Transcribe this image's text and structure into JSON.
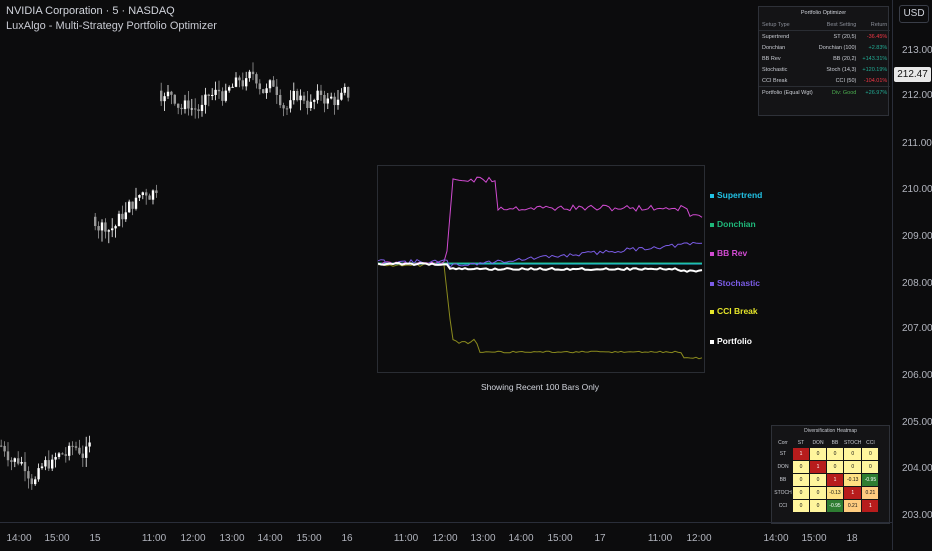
{
  "header": {
    "symbol_line": "NVIDIA Corporation · 5 · NASDAQ",
    "indicator_line": "LuxAlgo - Multi-Strategy Portfolio Optimizer"
  },
  "price_scale": {
    "currency": "USD",
    "current_price": "212.47",
    "ticks": [
      "213.00",
      "212.00",
      "211.00",
      "210.00",
      "209.00",
      "208.00",
      "207.00",
      "206.00",
      "205.00",
      "204.00",
      "203.00"
    ]
  },
  "time_axis": {
    "labels": [
      "14:00",
      "15:00",
      "15",
      "11:00",
      "12:00",
      "13:00",
      "14:00",
      "15:00",
      "16",
      "11:00",
      "12:00",
      "13:00",
      "14:00",
      "15:00",
      "17",
      "11:00",
      "12:00",
      "14:00",
      "15:00",
      "18"
    ]
  },
  "optimizer": {
    "title": "Portfolio Optimizer",
    "columns": [
      "Setup Type",
      "Best Setting",
      "Return"
    ],
    "rows": [
      {
        "type": "Supertrend",
        "setting": "ST (20,5)",
        "ret": "-36.45%",
        "sign": "neg"
      },
      {
        "type": "Donchian",
        "setting": "Donchian (100)",
        "ret": "+2.83%",
        "sign": "pos"
      },
      {
        "type": "BB Rev",
        "setting": "BB (20,2)",
        "ret": "+143.31%",
        "sign": "pos"
      },
      {
        "type": "Stochastic",
        "setting": "Stoch (14,3)",
        "ret": "+120.19%",
        "sign": "pos"
      },
      {
        "type": "CCI Break",
        "setting": "CCI (50)",
        "ret": "-104.01%",
        "sign": "neg"
      }
    ],
    "summary": {
      "type": "Portfolio (Equal Wgt)",
      "setting": "Div: Good",
      "ret": "+26.97%"
    }
  },
  "panel": {
    "note": "Showing Recent 100 Bars Only",
    "legend": [
      {
        "name": "Supertrend",
        "color": "#22c3e6"
      },
      {
        "name": "Donchian",
        "color": "#1fb87a"
      },
      {
        "name": "BB Rev",
        "color": "#d14bd1"
      },
      {
        "name": "Stochastic",
        "color": "#7b5ce6"
      },
      {
        "name": "CCI Break",
        "color": "#e6e62a"
      },
      {
        "name": "Portfolio",
        "color": "#ffffff"
      }
    ]
  },
  "heatmap": {
    "title": "Diversification Heatmap",
    "corner": "Corr",
    "labels": [
      "ST",
      "DON",
      "BB",
      "STOCH",
      "CCI"
    ],
    "values": [
      [
        "1",
        "0",
        "0",
        "0",
        "0"
      ],
      [
        "0",
        "1",
        "0",
        "0",
        "0"
      ],
      [
        "0",
        "0",
        "1",
        "-0.13",
        "-0.95"
      ],
      [
        "0",
        "0",
        "-0.13",
        "1",
        "0.21"
      ],
      [
        "0",
        "0",
        "-0.95",
        "0.21",
        "1"
      ]
    ]
  },
  "colors": {
    "background": "#0c0c0d",
    "candle_up": "#ffffff",
    "candle_down": "#9a9a9a",
    "heat_one": "#b71c1c",
    "heat_zero": "#fff59d",
    "heat_neg_small": "#ffe082",
    "heat_neg_large": "#2e7d32",
    "heat_pos_small": "#ffcc80"
  }
}
